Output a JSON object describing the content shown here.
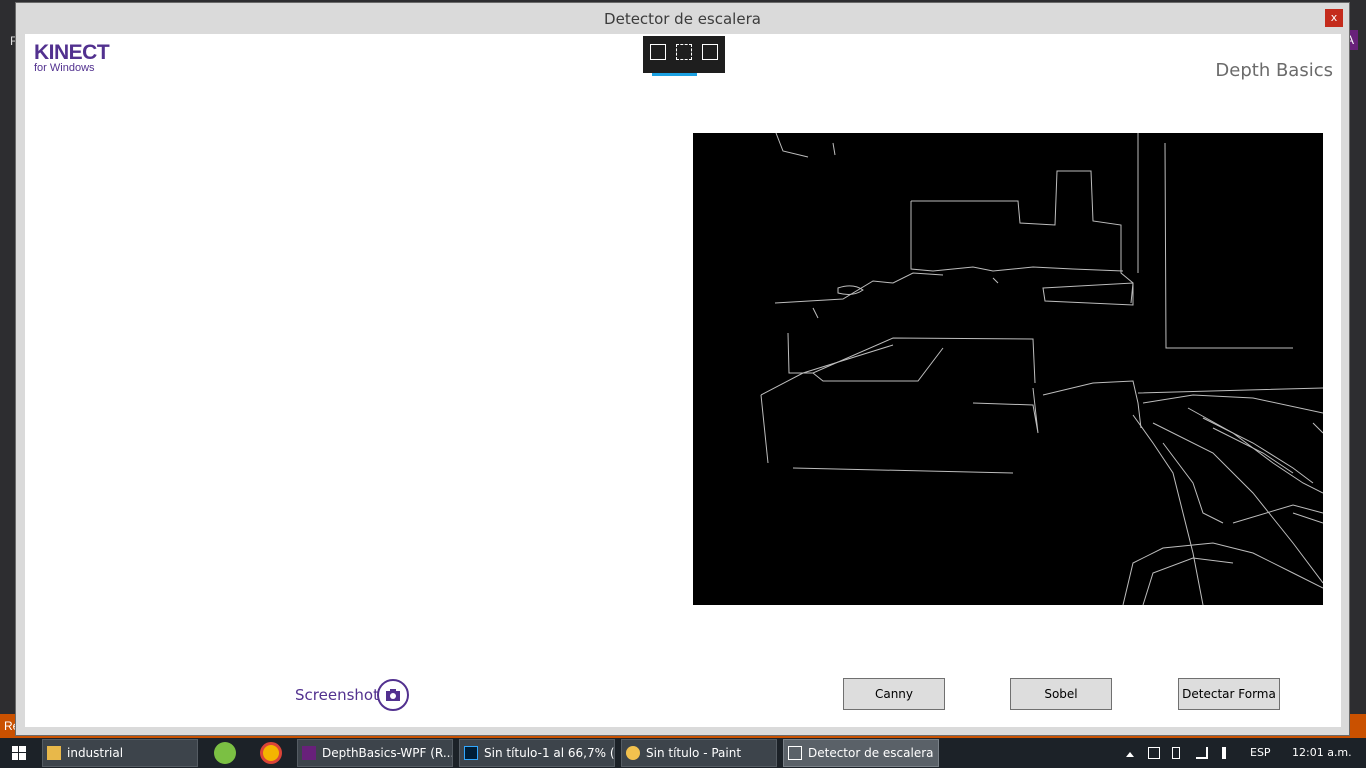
{
  "window": {
    "title": "Detector de escalera",
    "close_label": "x"
  },
  "logo": {
    "title": "KINECT",
    "subtitle": "for Windows"
  },
  "header": {
    "app_title": "Depth Basics"
  },
  "screenshot": {
    "label": "Screenshot"
  },
  "buttons": {
    "canny": "Canny",
    "sobel": "Sobel",
    "detect": "Detectar Forma"
  },
  "background": {
    "vs_badge": "A",
    "left_letter": "F",
    "bottom_left": "Re"
  },
  "taskbar": {
    "items": [
      {
        "label": "industrial"
      },
      {
        "label": "DepthBasics-WPF (R..."
      },
      {
        "label": "Sin título-1 al 66,7% (..."
      },
      {
        "label": "Sin título - Paint"
      },
      {
        "label": "Detector de escalera"
      }
    ],
    "tray": {
      "language": "ESP",
      "time": "12:01 a.m."
    }
  },
  "colors": {
    "kinect_purple": "#52318f",
    "canvas_bg": "#000000",
    "debug_accent": "#1ba1e2"
  }
}
